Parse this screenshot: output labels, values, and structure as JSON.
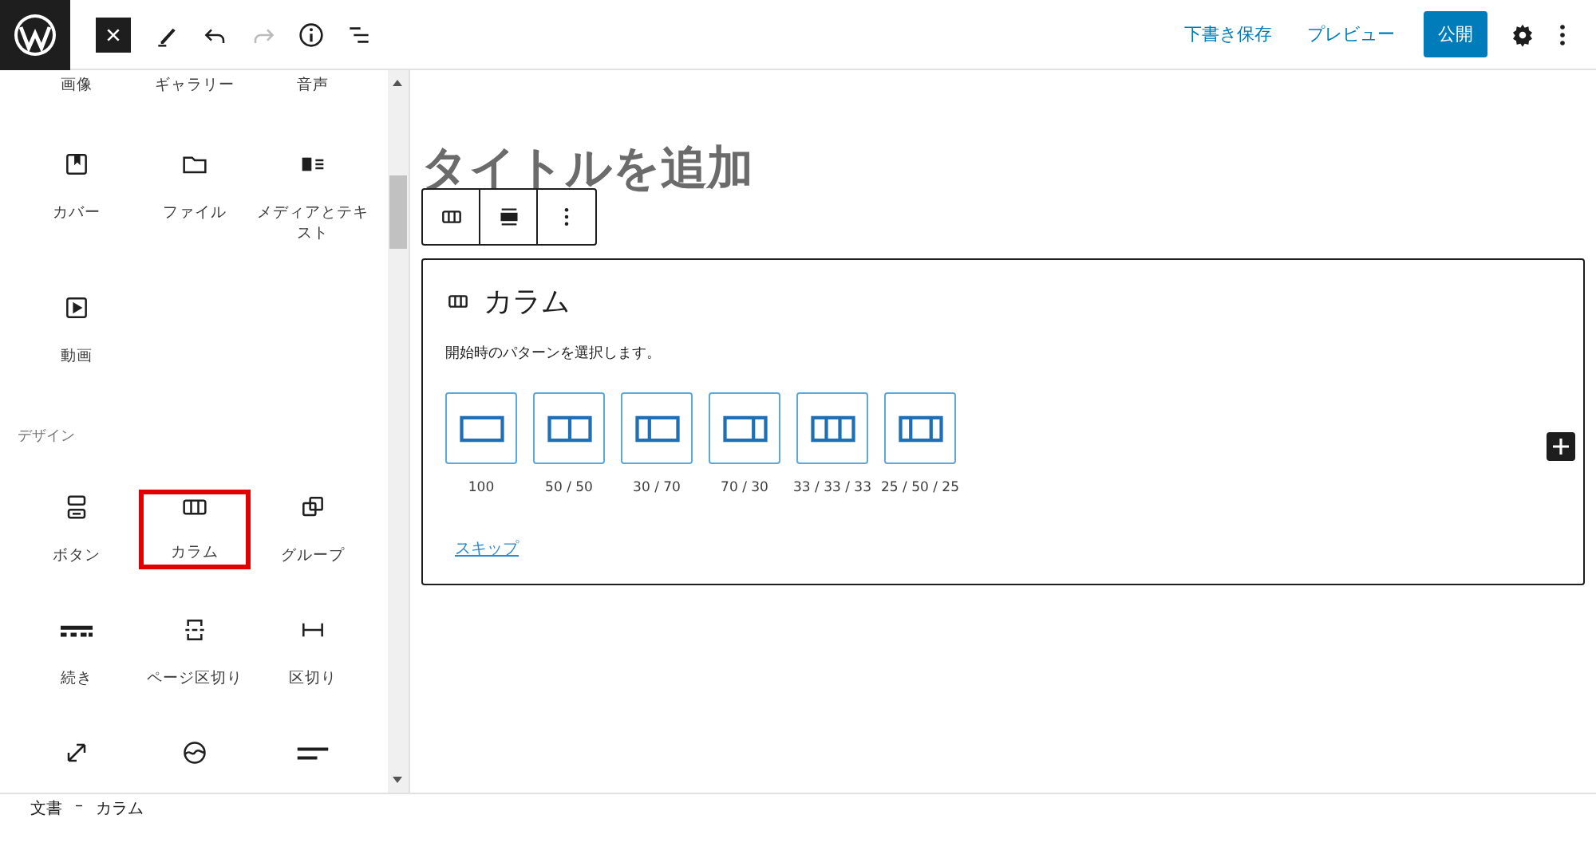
{
  "header": {
    "tools": [
      {
        "kind": "close",
        "disabled": false
      },
      {
        "kind": "edit",
        "disabled": false
      },
      {
        "kind": "undo",
        "disabled": false
      },
      {
        "kind": "redo",
        "disabled": true
      },
      {
        "kind": "info",
        "disabled": false
      },
      {
        "kind": "list",
        "disabled": false
      }
    ],
    "save_draft": "下書き保存",
    "preview": "プレビュー",
    "publish": "公開"
  },
  "inserter": {
    "sections": [
      {
        "items": [
          {
            "label": "画像",
            "highlighted": false
          },
          {
            "label": "ギャラリー",
            "highlighted": false
          },
          {
            "label": "音声",
            "highlighted": false
          },
          {
            "label": "カバー",
            "highlighted": false
          },
          {
            "label": "ファイル",
            "highlighted": false
          },
          {
            "label": "メディアとテキスト",
            "highlighted": false
          },
          {
            "label": "動画",
            "highlighted": false
          }
        ]
      },
      {
        "title": "デザイン",
        "items": [
          {
            "label": "ボタン",
            "highlighted": false
          },
          {
            "label": "カラム",
            "highlighted": true
          },
          {
            "label": "グループ",
            "highlighted": false
          },
          {
            "label": "続き",
            "highlighted": false
          },
          {
            "label": "ページ区切り",
            "highlighted": false
          },
          {
            "label": "区切り",
            "highlighted": false
          },
          {
            "highlighted": false
          },
          {
            "highlighted": false
          },
          {
            "highlighted": false
          }
        ]
      }
    ]
  },
  "editor": {
    "title_placeholder": "タイトルを追加",
    "block": {
      "title": "カラム",
      "instructions": "開始時のパターンを選択します。",
      "patterns": [
        {
          "label": "100"
        },
        {
          "label": "50 / 50"
        },
        {
          "label": "30 / 70"
        },
        {
          "label": "70 / 30"
        },
        {
          "label": "33 / 33 / 33"
        },
        {
          "label": "25 / 50 / 25"
        }
      ],
      "skip": "スキップ"
    }
  },
  "breadcrumb": {
    "items": [
      "文書",
      "カラム"
    ],
    "separator": "–"
  }
}
